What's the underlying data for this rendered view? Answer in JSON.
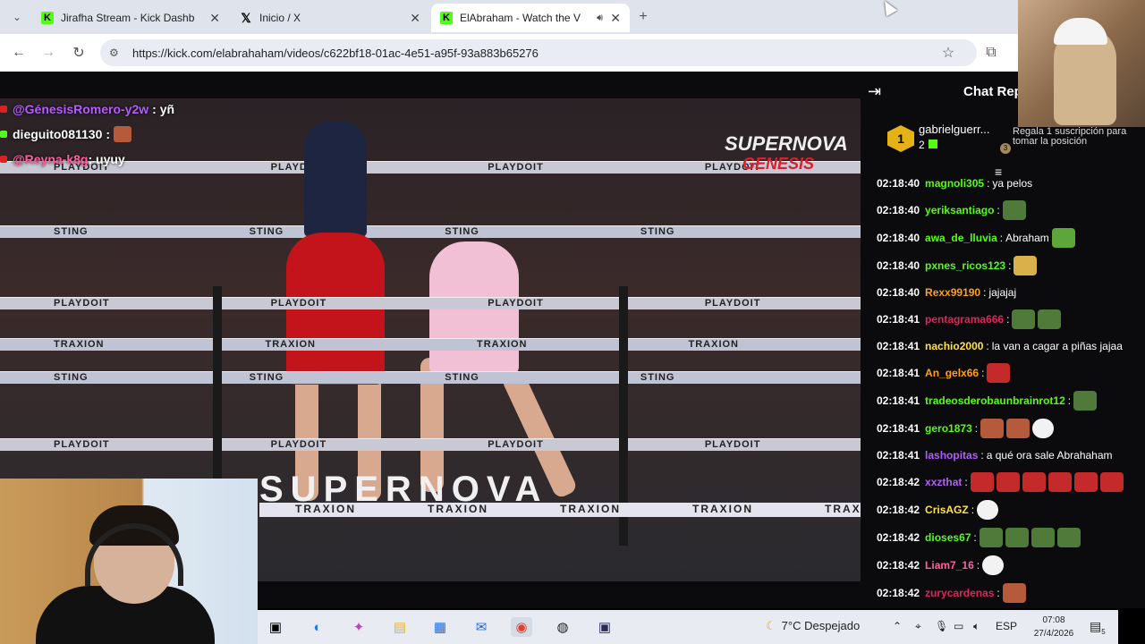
{
  "browser": {
    "tabs": [
      {
        "label": "Jirafha Stream - Kick Dashboard",
        "favicon": "kick-icon"
      },
      {
        "label": "Inicio / X",
        "favicon": "x-icon"
      },
      {
        "label": "ElAbraham - Watch the V",
        "favicon": "kick-icon",
        "active": true
      }
    ],
    "url": "https://kick.com/elabrahaham/videos/c622bf18-01ac-4e51-a95f-93a883b65276"
  },
  "video": {
    "overlay_chat": [
      {
        "user": "@GénesisRomero-y2w",
        "text": ": yñ",
        "color": "#b55cff"
      },
      {
        "user": "dieguito081130",
        "text": " :",
        "color": "#ffffff"
      },
      {
        "user": "@Reyna-k8g",
        "text": ": uyuy",
        "color": "#ff5fa2"
      }
    ],
    "rope_brand": "PLAYDOIT",
    "rope_brand_2": "TRAXION",
    "rope_brand_3": "STING",
    "event_logo_1": "SUPERNOVA",
    "event_logo_2": "GENESIS",
    "apron_text": "SUPERNOVA"
  },
  "chat": {
    "title": "Chat Rep",
    "pinned": {
      "rank": "1",
      "name": "gabrielguerr...",
      "count": "2"
    },
    "sub_promo": "Regala 1 suscripción para tomar la posición",
    "sub_promo_rank": "3",
    "messages": [
      {
        "time": "02:18:40",
        "user": "magnoli305",
        "color": "#53fc18",
        "text": "ya pelos",
        "emotes": []
      },
      {
        "time": "02:18:40",
        "user": "yeriksantiago",
        "color": "#53fc18",
        "text": "",
        "emotes": [
          "e-frog"
        ]
      },
      {
        "time": "02:18:40",
        "user": "awa_de_lluvia",
        "color": "#53fc18",
        "text": "Abraham",
        "emotes": [
          "e-green"
        ]
      },
      {
        "time": "02:18:40",
        "user": "pxnes_ricos123",
        "color": "#53fc18",
        "text": "",
        "emotes": [
          "e-gold"
        ]
      },
      {
        "time": "02:18:40",
        "user": "Rexx99190",
        "color": "#ff9f1a",
        "text": "jajajaj",
        "emotes": []
      },
      {
        "time": "02:18:41",
        "user": "pentagrama666",
        "color": "#e0245e",
        "text": "",
        "emotes": [
          "e-frog",
          "e-frog"
        ]
      },
      {
        "time": "02:18:41",
        "user": "nachio2000",
        "color": "#ffe14d",
        "text": "la van a cagar a piñas jajaa",
        "emotes": []
      },
      {
        "time": "02:18:41",
        "user": "An_gelx66",
        "color": "#ff9f1a",
        "text": "",
        "emotes": [
          "e-red"
        ]
      },
      {
        "time": "02:18:41",
        "user": "tradeosderobaunbrainrot12",
        "color": "#53fc18",
        "text": "",
        "emotes": [
          "e-frog"
        ]
      },
      {
        "time": "02:18:41",
        "user": "gero1873",
        "color": "#53fc18",
        "text": "",
        "emotes": [
          "e-face",
          "e-face",
          "e-ghost"
        ]
      },
      {
        "time": "02:18:41",
        "user": "lashopitas",
        "color": "#b55cff",
        "text": "a qué ora sale Abrahaham",
        "emotes": []
      },
      {
        "time": "02:18:42",
        "user": "xxzthat",
        "color": "#b55cff",
        "text": "",
        "emotes": [
          "e-red",
          "e-red",
          "e-red",
          "e-red",
          "e-red",
          "e-red"
        ]
      },
      {
        "time": "02:18:42",
        "user": "CrisAGZ",
        "color": "#ffe14d",
        "text": "",
        "emotes": [
          "e-ghost"
        ]
      },
      {
        "time": "02:18:42",
        "user": "dioses67",
        "color": "#53fc18",
        "text": "",
        "emotes": [
          "e-frog",
          "e-frog",
          "e-frog",
          "e-frog"
        ]
      },
      {
        "time": "02:18:42",
        "user": "Liam7_16",
        "color": "#ff5fa2",
        "text": "",
        "emotes": [
          "e-ghost"
        ]
      },
      {
        "time": "02:18:42",
        "user": "zurycardenas",
        "color": "#e0245e",
        "text": "",
        "emotes": [
          "e-face"
        ]
      }
    ]
  },
  "taskbar": {
    "weather": "7°C Despejado",
    "lang": "ESP",
    "time": "07:08",
    "date": "27/4/2026",
    "notif_count": "5"
  },
  "colors": {
    "kick_green": "#53fc18",
    "chat_bg": "#0b0b0d",
    "taskbar_bg": "#e8ecf2"
  }
}
